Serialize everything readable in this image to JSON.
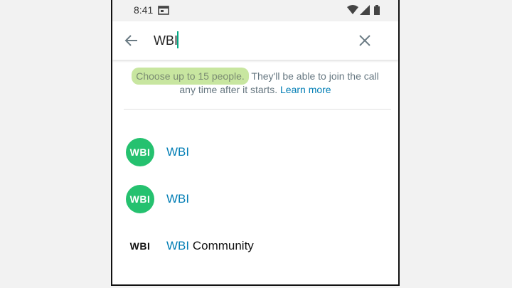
{
  "status": {
    "time": "8:41"
  },
  "search": {
    "value": "WBI",
    "placeholder": ""
  },
  "info": {
    "highlight": "Choose up to 15 people.",
    "rest": " They'll be able to join the call any time after it starts. ",
    "link": "Learn more"
  },
  "contacts": [
    {
      "avatar_text": "WBI",
      "name_match": "WBI",
      "name_rest": ""
    },
    {
      "avatar_text": "WBI",
      "name_match": "WBI",
      "name_rest": ""
    },
    {
      "avatar_text": "WBI",
      "name_match": "WBI",
      "name_rest": " Community"
    }
  ],
  "colors": {
    "accent": "#027eb5",
    "avatar_green": "#25c16f",
    "highlight": "#c8e6a0"
  }
}
